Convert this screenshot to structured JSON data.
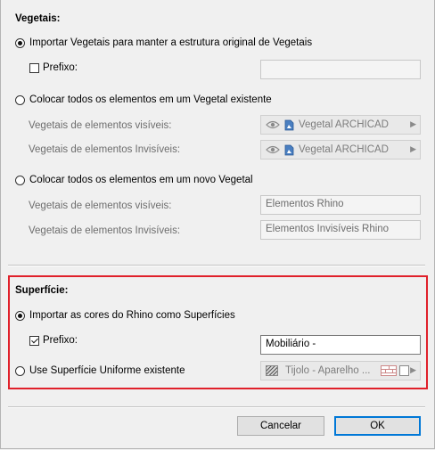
{
  "vegetais": {
    "title": "Vegetais:",
    "opt_import": "Importar Vegetais para manter a estrutura original de Vegetais",
    "prefix_label": "Prefixo:",
    "prefix_value": "",
    "opt_existing": "Colocar todos os elementos em um Vegetal existente",
    "visible_label": "Vegetais de elementos visíveis:",
    "visible_value": "Vegetal ARCHICAD",
    "invisible_label": "Vegetais de elementos Invisíveis:",
    "invisible_value": "Vegetal ARCHICAD",
    "opt_new": "Colocar todos os elementos em um novo Vegetal",
    "new_visible_label": "Vegetais de elementos visíveis:",
    "new_visible_value": "Elementos Rhino",
    "new_invisible_label": "Vegetais de elementos Invisíveis:",
    "new_invisible_value": "Elementos Invisíveis Rhino"
  },
  "superficie": {
    "title": "Superfície:",
    "opt_import": "Importar as cores do Rhino como Superfícies",
    "prefix_label": "Prefixo:",
    "prefix_value": "Mobiliário -",
    "opt_uniform": "Use Superfície Uniforme existente",
    "uniform_value": "Tijolo - Aparelho ..."
  },
  "buttons": {
    "cancel": "Cancelar",
    "ok": "OK"
  },
  "state": {
    "vegetais_selected": "import",
    "vegetais_prefix_checked": false,
    "superficie_selected": "import",
    "superficie_prefix_checked": true
  },
  "colors": {
    "highlight_box": "#e0202a",
    "default_button": "#0078d7"
  },
  "icons": [
    "eye-icon",
    "layer-icon",
    "dropdown-arrow-icon",
    "texture-icon",
    "brick-icon",
    "image-icon"
  ]
}
